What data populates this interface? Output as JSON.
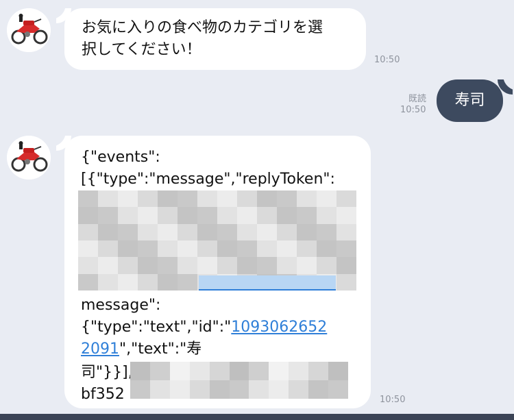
{
  "messages": {
    "prompt": {
      "line1": "お気に入りの食べ物のカテゴリを選",
      "line2": "択してください！",
      "time": "10:50"
    },
    "reply": {
      "text": "寿司",
      "read_label": "既読",
      "time": "10:50"
    },
    "json_msg": {
      "line1": "{\"events\":",
      "line2": "[{\"type\":\"message\",\"replyToken\":",
      "line3": "message\":",
      "line4_pre": "{\"type\":\"text\",\"id\":\"",
      "line4_link": "1093062652",
      "line5_link": "2091",
      "line5_post": "\",\"text\":\"寿",
      "line6": "司\"}}],",
      "line7": "bf352",
      "time": "10:50"
    }
  },
  "colors": {
    "background": "#e9ecf3",
    "incoming_bubble": "#ffffff",
    "outgoing_bubble": "#3d4a5f",
    "link": "#2f7fd8"
  },
  "icons": {
    "avatar": "motorcycle-icon"
  }
}
